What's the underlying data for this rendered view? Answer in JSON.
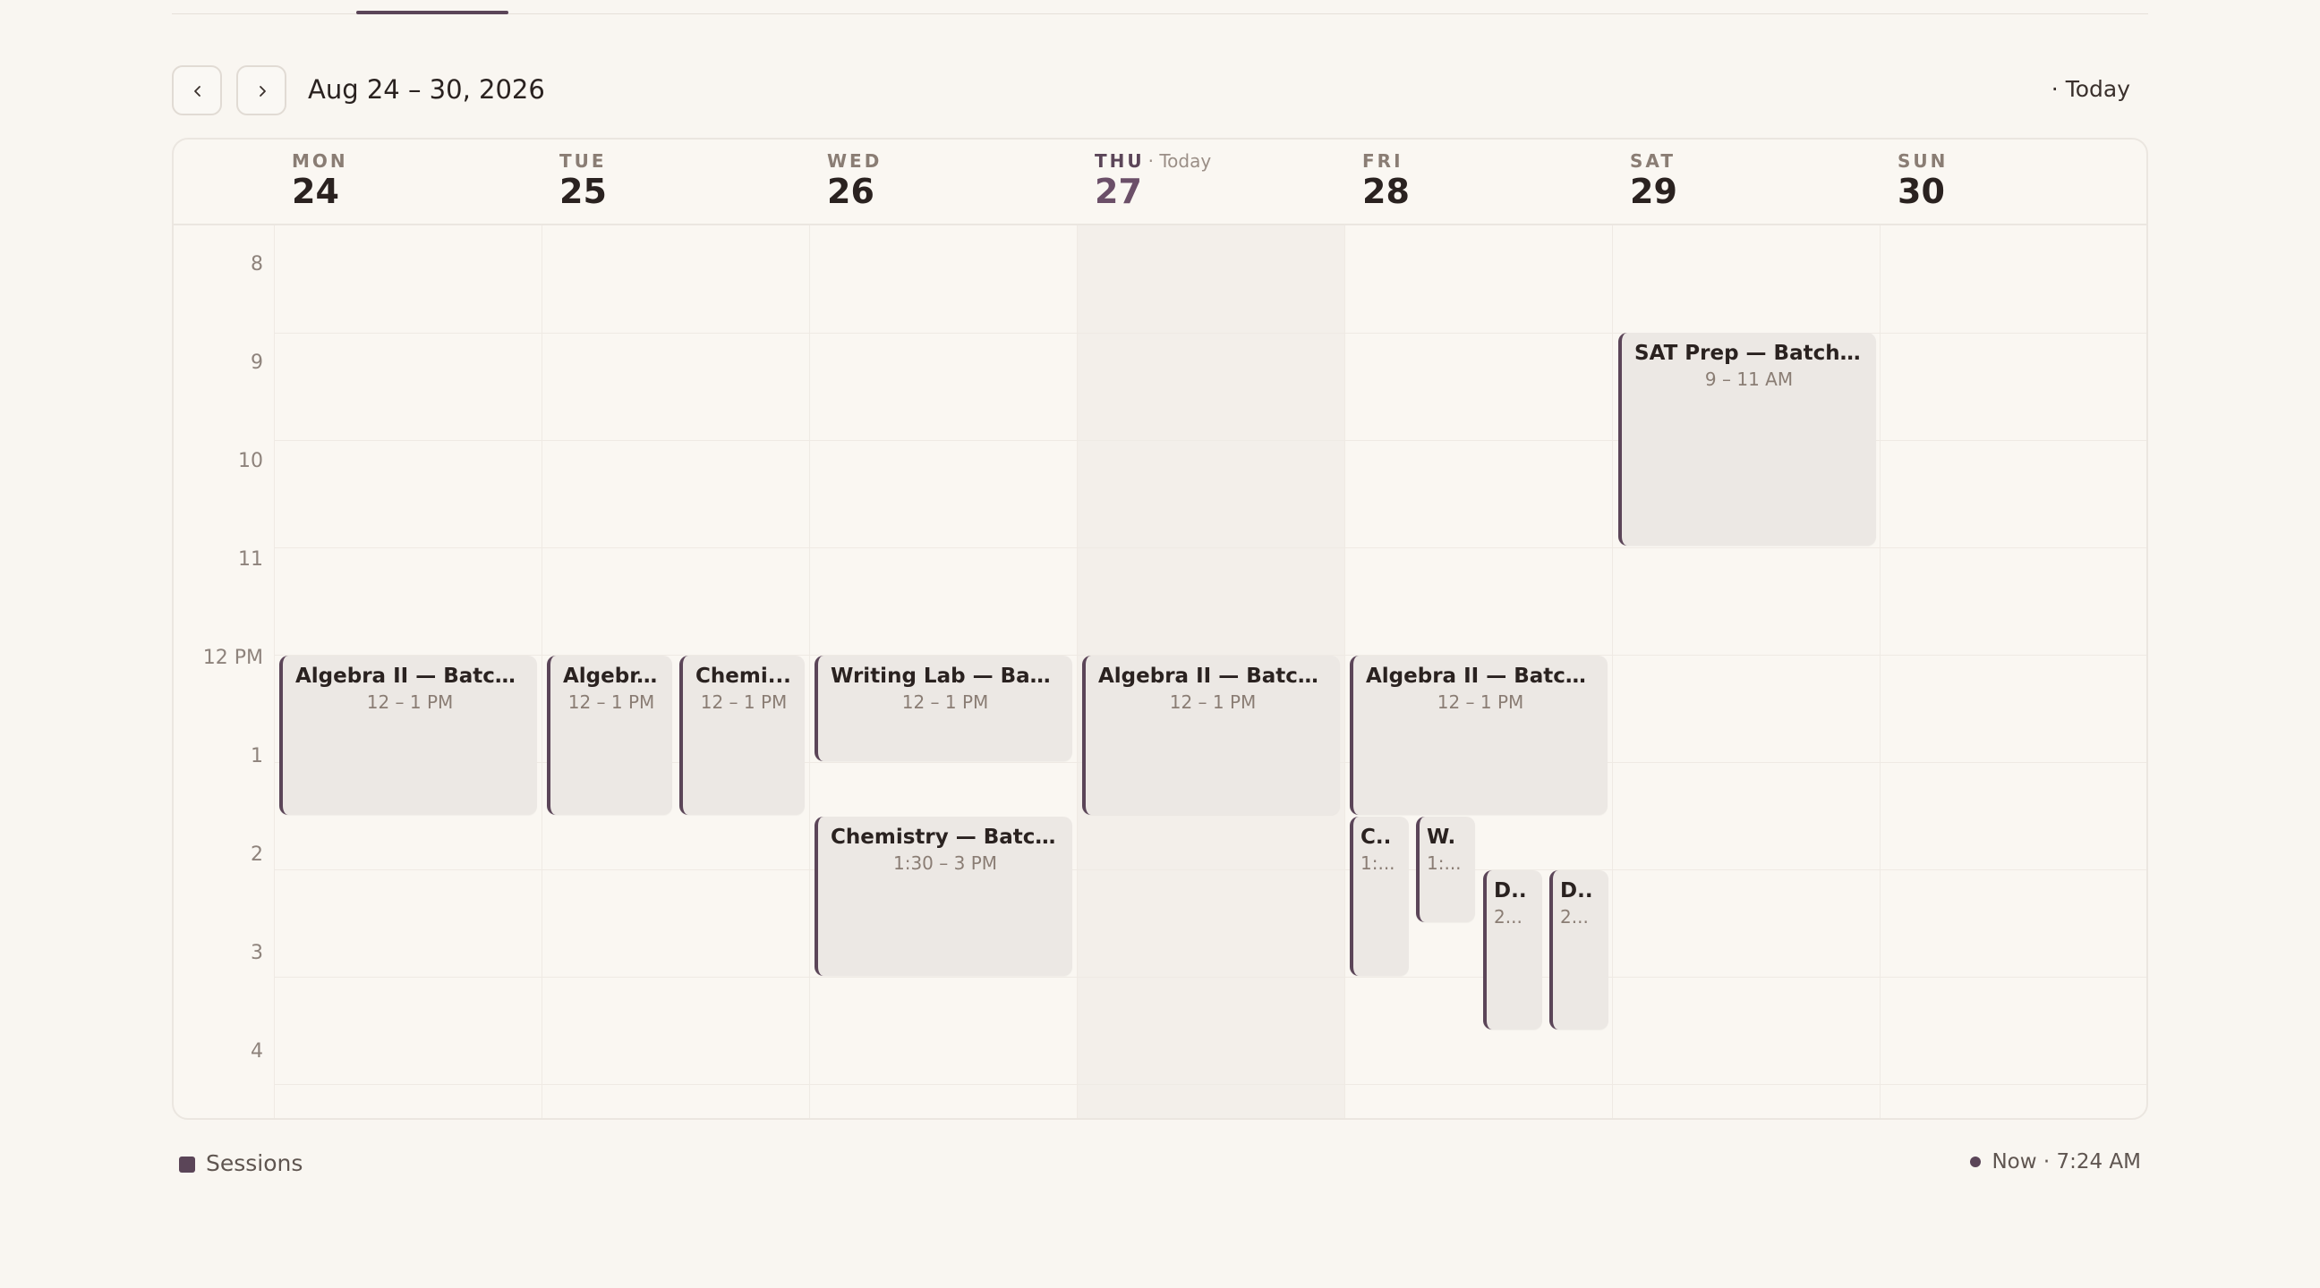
{
  "toolbar": {
    "range_title": "Aug 24 – 30, 2026",
    "today_label": "· Today"
  },
  "days": [
    {
      "dow": "MON",
      "num": "24"
    },
    {
      "dow": "TUE",
      "num": "25"
    },
    {
      "dow": "WED",
      "num": "26"
    },
    {
      "dow": "THU",
      "num": "27",
      "tag": "· Today"
    },
    {
      "dow": "FRI",
      "num": "28"
    },
    {
      "dow": "SAT",
      "num": "29"
    },
    {
      "dow": "SUN",
      "num": "30"
    }
  ],
  "hours": [
    "8",
    "9",
    "10",
    "11",
    "12 PM",
    "1",
    "2",
    "3",
    "4"
  ],
  "events": [
    {
      "title": "SAT Prep — Batch B ...",
      "time": "9 – 11 AM"
    },
    {
      "title": "Algebra II — Batch ...",
      "time": "12 – 1 PM"
    },
    {
      "title": "Algebr...",
      "time": "12 – 1 PM"
    },
    {
      "title": "Chemi...",
      "time": "12 – 1 PM"
    },
    {
      "title": "Writing Lab — Batc...",
      "time": "12 – 1 PM"
    },
    {
      "title": "Chemistry — Batch ...",
      "time": "1:30 – 3 PM"
    },
    {
      "title": "Algebra II — Batch ...",
      "time": "12 – 1 PM"
    },
    {
      "title": "Algebra II — Batch ...",
      "time": "12 – 1 PM"
    },
    {
      "title": "C..",
      "time": "1:..."
    },
    {
      "title": "W.",
      "time": "1:..."
    },
    {
      "title": "D..",
      "time": "2..."
    },
    {
      "title": "D..",
      "time": "2..."
    }
  ],
  "legend": {
    "label": "Sessions",
    "color": "#5b4558"
  },
  "now": {
    "text": "Now · 7:24 AM"
  },
  "colors": {
    "accent": "#5b4558",
    "event_bg": "#ece8e4",
    "background": "#f9f6f1"
  }
}
